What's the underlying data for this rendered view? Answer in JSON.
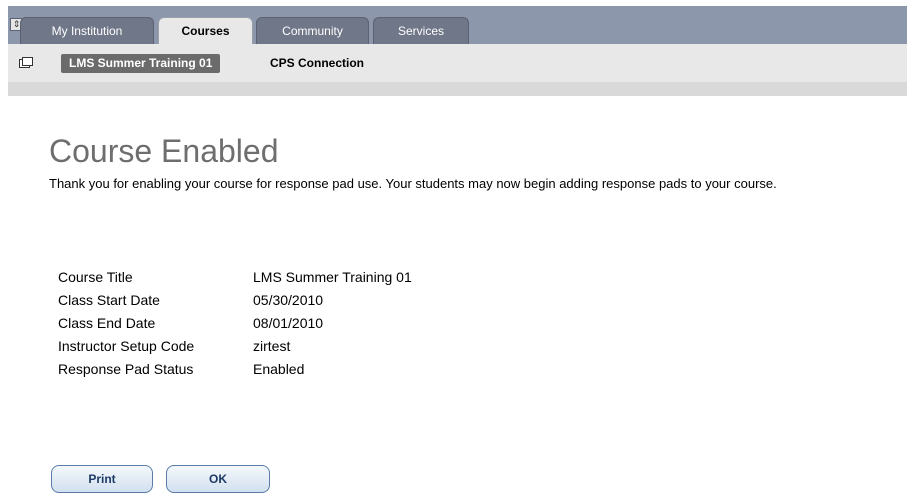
{
  "tabs": [
    {
      "label": "My Institution",
      "active": false
    },
    {
      "label": "Courses",
      "active": true
    },
    {
      "label": "Community",
      "active": false
    },
    {
      "label": "Services",
      "active": false
    }
  ],
  "breadcrumb": {
    "course": "LMS Summer Training 01",
    "current": "CPS Connection"
  },
  "page": {
    "title": "Course Enabled",
    "intro": "Thank you for enabling your course for response pad use. Your students may now begin adding response pads to your course."
  },
  "details": [
    {
      "label": "Course Title",
      "value": "LMS Summer Training 01"
    },
    {
      "label": "Class Start Date",
      "value": "05/30/2010"
    },
    {
      "label": "Class End Date",
      "value": "08/01/2010"
    },
    {
      "label": "Instructor Setup Code",
      "value": "zirtest"
    },
    {
      "label": "Response Pad Status",
      "value": "Enabled"
    }
  ],
  "buttons": {
    "print": "Print",
    "ok": "OK"
  },
  "colors": {
    "tabstrip": "#8c97ab",
    "tab_inactive": "#6f7788",
    "title_gray": "#6e6e6e",
    "button_border": "#5b7ca7"
  },
  "icons": {
    "collapse": "collapse-toggle-icon",
    "course_menu": "course-menu-icon"
  }
}
